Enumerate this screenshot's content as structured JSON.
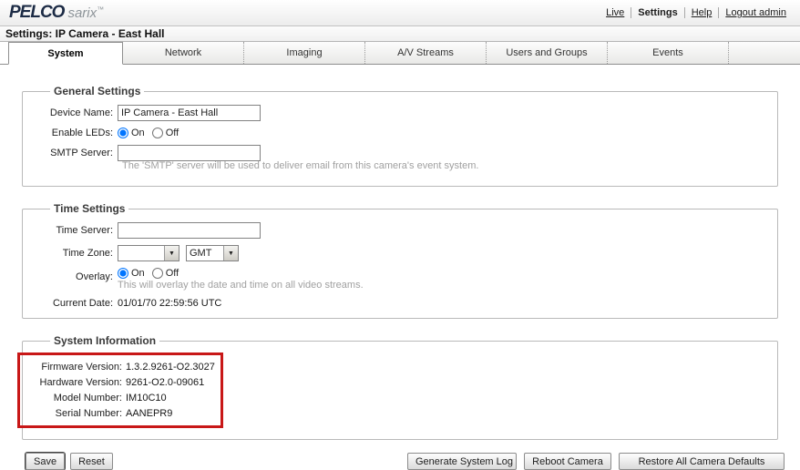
{
  "header": {
    "logo": {
      "brand": "PELCO",
      "sub": "sarix",
      "tm": "™"
    },
    "nav": {
      "live": "Live",
      "settings": "Settings",
      "help": "Help",
      "logout": "Logout admin"
    }
  },
  "title_bar": {
    "title": "Settings: IP Camera - East Hall"
  },
  "tabs": [
    {
      "label": "System",
      "active": true
    },
    {
      "label": "Network",
      "active": false
    },
    {
      "label": "Imaging",
      "active": false
    },
    {
      "label": "A/V Streams",
      "active": false
    },
    {
      "label": "Users and Groups",
      "active": false
    },
    {
      "label": "Events",
      "active": false
    }
  ],
  "radio_labels": {
    "on": "On",
    "off": "Off"
  },
  "general_settings": {
    "legend": "General Settings",
    "device_name_label": "Device Name:",
    "device_name_value": "IP Camera - East Hall",
    "enable_leds_label": "Enable LEDs:",
    "enable_leds_value": "On",
    "smtp_label": "SMTP Server:",
    "smtp_value": "",
    "smtp_help": "The 'SMTP' server will be used to deliver email from this camera's event system."
  },
  "time_settings": {
    "legend": "Time Settings",
    "time_server_label": "Time Server:",
    "time_server_value": "",
    "time_zone_label": "Time Zone:",
    "time_zone_offset_value": "",
    "time_zone_region_value": "GMT",
    "overlay_label": "Overlay:",
    "overlay_value": "On",
    "overlay_help": "This will overlay the date and time on all video streams.",
    "current_date_label": "Current Date:",
    "current_date_value": "01/01/70 22:59:56 UTC"
  },
  "system_information": {
    "legend": "System Information",
    "highlight_color": "#c81717",
    "rows": [
      {
        "label": "Firmware Version:",
        "value": "1.3.2.9261-O2.3027"
      },
      {
        "label": "Hardware Version:",
        "value": "9261-O2.0-09061"
      },
      {
        "label": "Model Number:",
        "value": "IM10C10"
      },
      {
        "label": "Serial Number:",
        "value": "AANEPR9"
      }
    ]
  },
  "footer": {
    "save_label": "Save",
    "reset_label": "Reset",
    "generate_log_label": "Generate System Log",
    "reboot_label": "Reboot Camera",
    "restore_label": "Restore All Camera Defaults"
  }
}
